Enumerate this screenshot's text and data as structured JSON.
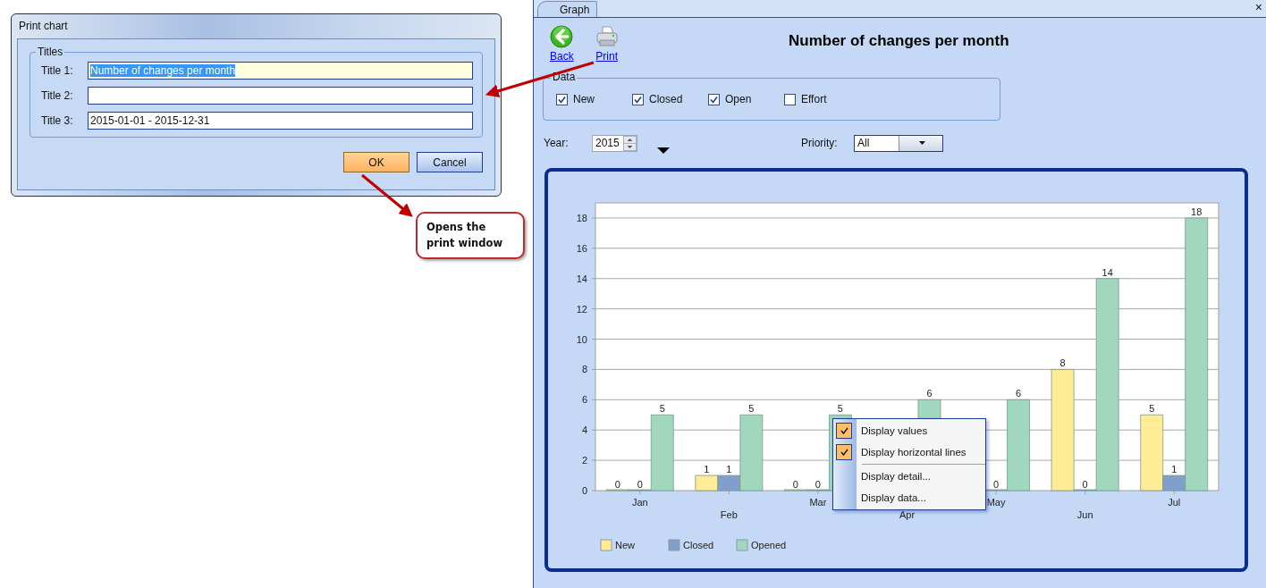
{
  "print_dialog": {
    "title": "Print chart",
    "group": "Titles",
    "fields": [
      {
        "label": "Title 1:",
        "value": "Number of changes per month",
        "focused": true
      },
      {
        "label": "Title 2:",
        "focused": false
      },
      {
        "label": "Title 3:",
        "value": "2015-01-01 - 2015-12-31",
        "focused": false
      }
    ],
    "buttons": [
      {
        "label": "OK",
        "default": true
      },
      {
        "label": "Cancel",
        "default": false
      }
    ]
  },
  "callout": {
    "text": "Opens the print window"
  },
  "graph_window": {
    "tabs": [
      {
        "label": "Graph",
        "selected": true
      }
    ],
    "close": "×",
    "toolbar": [
      {
        "label": "Back",
        "kind": "back"
      },
      {
        "label": "Print",
        "kind": "print"
      }
    ],
    "title": "Number of changes per month",
    "data_group": {
      "label": "Data",
      "options": [
        {
          "label": "New",
          "checked": true
        },
        {
          "label": "Closed",
          "checked": true
        },
        {
          "label": "Open",
          "checked": true
        },
        {
          "label": "Effort",
          "checked": false
        }
      ]
    },
    "year": {
      "label": "Year:",
      "value": "2015"
    },
    "priority": {
      "label": "Priority:",
      "value": "All"
    },
    "chart_data": {
      "type": "bar",
      "categories": [
        "Jan",
        "Feb",
        "Mar",
        "Apr",
        "May",
        "Jun",
        "Jul"
      ],
      "series": [
        {
          "name": "New",
          "color": "#ffec94",
          "values": [
            0,
            1,
            0,
            null,
            null,
            8,
            5
          ]
        },
        {
          "name": "Closed",
          "color": "#809fcc",
          "values": [
            0,
            1,
            0,
            null,
            0,
            0,
            1
          ]
        },
        {
          "name": "Opened",
          "color": "#a0d7be",
          "values": [
            5,
            5,
            5,
            6,
            6,
            14,
            18
          ]
        }
      ],
      "ylim": [
        0,
        19
      ],
      "yticks": [
        0,
        2,
        4,
        6,
        8,
        10,
        12,
        14,
        16,
        18
      ],
      "data_labels": true,
      "grid": true,
      "legend": true
    },
    "context_menu": {
      "groups": [
        [
          {
            "label": "Display values",
            "checked": true
          },
          {
            "label": "Display horizontal lines",
            "checked": true
          }
        ],
        [
          {
            "label": "Display detail...",
            "checked": false
          },
          {
            "label": "Display data...",
            "checked": false
          }
        ]
      ]
    }
  }
}
